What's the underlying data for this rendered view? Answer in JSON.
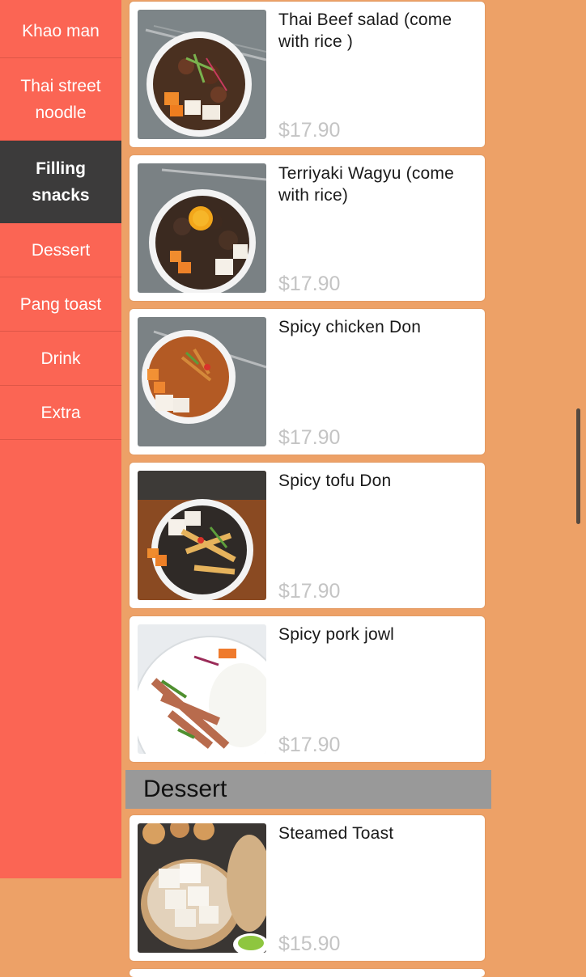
{
  "sidebar": {
    "items": [
      {
        "label": "Khao man",
        "active": false
      },
      {
        "label": "Thai street noodle",
        "active": false
      },
      {
        "label": "Filling snacks",
        "active": true
      },
      {
        "label": "Dessert",
        "active": false
      },
      {
        "label": "Pang toast",
        "active": false
      },
      {
        "label": "Drink",
        "active": false
      },
      {
        "label": "Extra",
        "active": false
      }
    ]
  },
  "menu": {
    "items": [
      {
        "name": "Thai Beef salad (come with rice )",
        "price": "$17.90",
        "image": "beef-salad-bowl-image"
      },
      {
        "name": "Terriyaki Wagyu (come with rice)",
        "price": "$17.90",
        "image": "wagyu-bowl-image"
      },
      {
        "name": "Spicy chicken Don",
        "price": "$17.90",
        "image": "chicken-don-image"
      },
      {
        "name": "Spicy tofu Don",
        "price": "$17.90",
        "image": "tofu-don-image"
      },
      {
        "name": "Spicy pork jowl",
        "price": "$17.90",
        "image": "pork-jowl-image"
      }
    ],
    "dessert_header": "Dessert",
    "dessert_items": [
      {
        "name": "Steamed Toast",
        "price": "$15.90",
        "image": "steamed-toast-image"
      }
    ]
  },
  "colors": {
    "background": "#eda167",
    "sidebar": "#fb6554",
    "sidebar_active": "#3c3b3b",
    "section_header": "#999999",
    "price": "#c4c4c4"
  }
}
